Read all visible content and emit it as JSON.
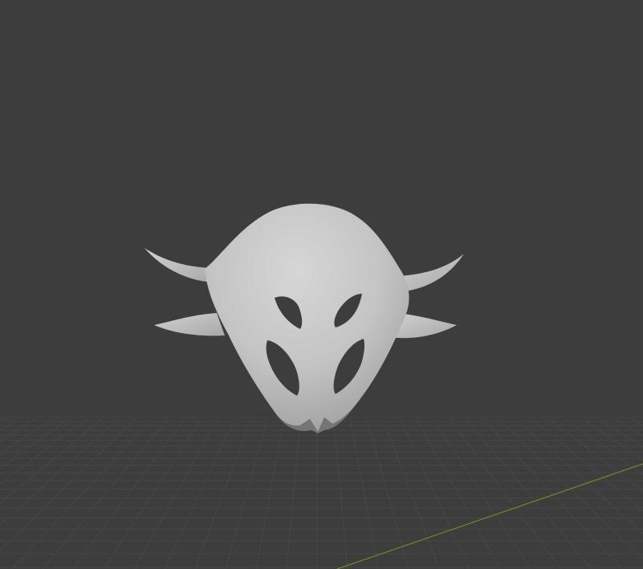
{
  "viewport": {
    "background_color": "#3d3d3d",
    "floor_grid_color": "#474747",
    "x_axis_color": "#6a8a2a",
    "object_color": "#c8c8c8"
  },
  "scene_object": {
    "type": "sculpted-mask-mesh",
    "eye_holes": 4,
    "side_horns": 4
  }
}
